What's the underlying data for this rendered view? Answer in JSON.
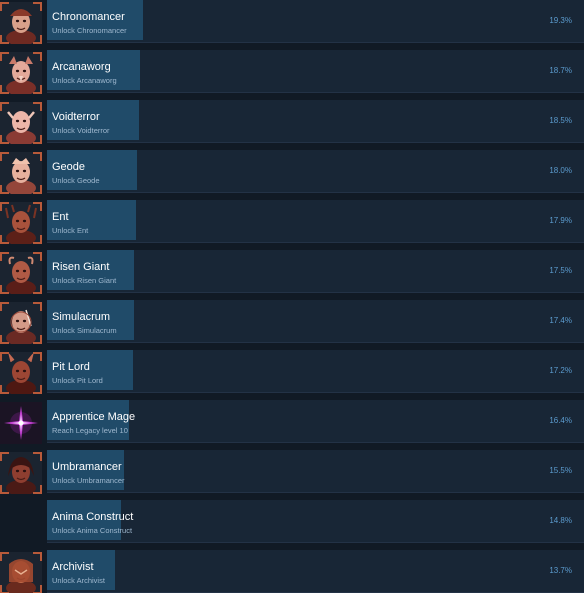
{
  "colors": {
    "page_background": "#111a25",
    "row_background": "#182636",
    "progress_fill": "#204b69",
    "title_text": "#ffffff",
    "description_text": "#9fb8cf",
    "percent_text": "#5c9ccf",
    "icon_frame": "#b85a3a",
    "icon_glow_magenta": "#c03fd0"
  },
  "achievements": [
    {
      "title": "Chronomancer",
      "description": "Unlock Chronomancer",
      "percent_label": "19.3%",
      "percent": 19.3,
      "icon": "chronomancer-icon"
    },
    {
      "title": "Arcanaworg",
      "description": "Unlock Arcanaworg",
      "percent_label": "18.7%",
      "percent": 18.7,
      "icon": "arcanaworg-icon"
    },
    {
      "title": "Voidterror",
      "description": "Unlock Voidterror",
      "percent_label": "18.5%",
      "percent": 18.5,
      "icon": "voidterror-icon"
    },
    {
      "title": "Geode",
      "description": "Unlock Geode",
      "percent_label": "18.0%",
      "percent": 18.0,
      "icon": "geode-icon"
    },
    {
      "title": "Ent",
      "description": "Unlock Ent",
      "percent_label": "17.9%",
      "percent": 17.9,
      "icon": "ent-icon"
    },
    {
      "title": "Risen Giant",
      "description": "Unlock Risen Giant",
      "percent_label": "17.5%",
      "percent": 17.5,
      "icon": "risen-giant-icon"
    },
    {
      "title": "Simulacrum",
      "description": "Unlock Simulacrum",
      "percent_label": "17.4%",
      "percent": 17.4,
      "icon": "simulacrum-icon"
    },
    {
      "title": "Pit Lord",
      "description": "Unlock Pit Lord",
      "percent_label": "17.2%",
      "percent": 17.2,
      "icon": "pit-lord-icon"
    },
    {
      "title": "Apprentice Mage",
      "description": "Reach Legacy level 10",
      "percent_label": "16.4%",
      "percent": 16.4,
      "icon": "apprentice-mage-icon"
    },
    {
      "title": "Umbramancer",
      "description": "Unlock Umbramancer",
      "percent_label": "15.5%",
      "percent": 15.5,
      "icon": "umbramancer-icon"
    },
    {
      "title": "Anima Construct",
      "description": "Unlock Anima Construct",
      "percent_label": "14.8%",
      "percent": 14.8,
      "icon": ""
    },
    {
      "title": "Archivist",
      "description": "Unlock Archivist",
      "percent_label": "13.7%",
      "percent": 13.7,
      "icon": "archivist-icon"
    }
  ]
}
